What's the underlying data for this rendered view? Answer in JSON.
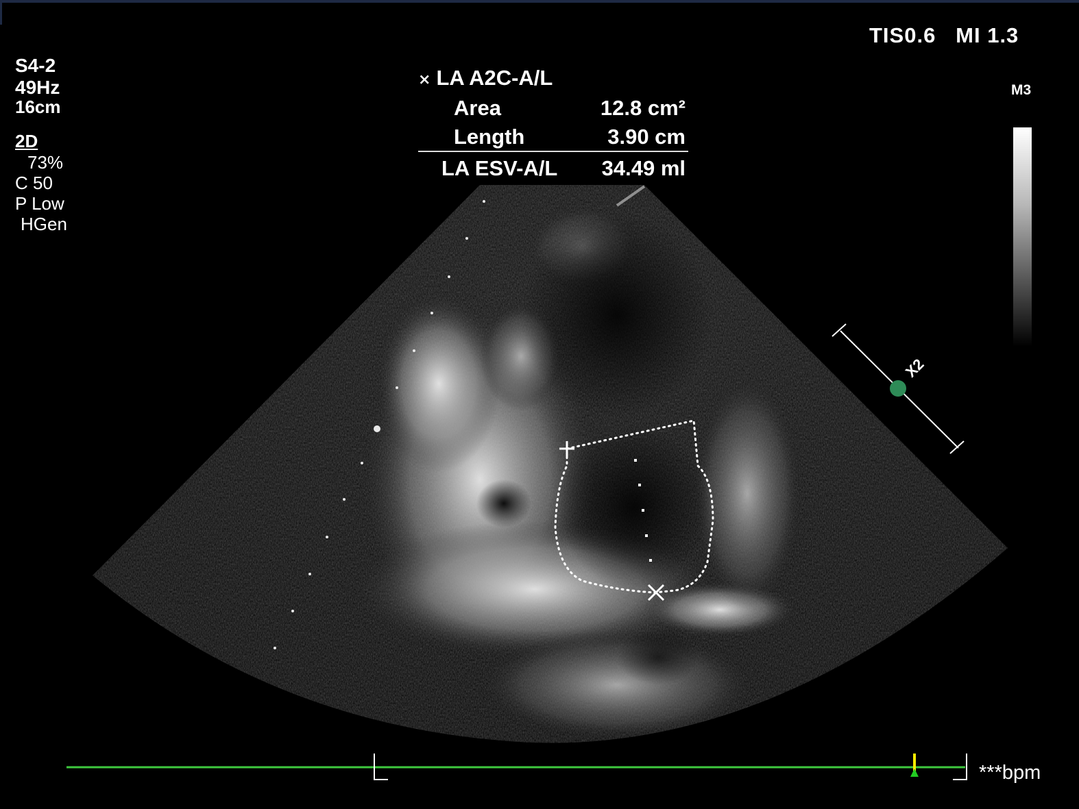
{
  "probe": {
    "transducer": "S4-2",
    "frame_rate": "49Hz",
    "depth": "16cm"
  },
  "imaging": {
    "mode": "2D",
    "gain": "73%",
    "compression": "C 50",
    "persistence": "P Low",
    "harmonic": "HGen"
  },
  "safety": {
    "indices": "TIS0.6   MI 1.3"
  },
  "grayscale_map": "M3",
  "measurement": {
    "title": "LA A2C-A/L",
    "rows": [
      {
        "label": "Area",
        "value": "12.8 cm²"
      },
      {
        "label": "Length",
        "value": "3.90 cm"
      }
    ],
    "result": {
      "label": "LA ESV-A/L",
      "value": "34.49 ml"
    }
  },
  "zoom_marker": "X2",
  "heart_rate": "***bpm",
  "colors": {
    "ecg_line": "#3ec83e",
    "zoom_dot": "#2e8b57",
    "marker_yellow": "#ffee00",
    "marker_green": "#22cc22"
  },
  "icons": [
    "caliper-x-icon",
    "caliper-cross-icon",
    "zoom-handle-icon"
  ]
}
